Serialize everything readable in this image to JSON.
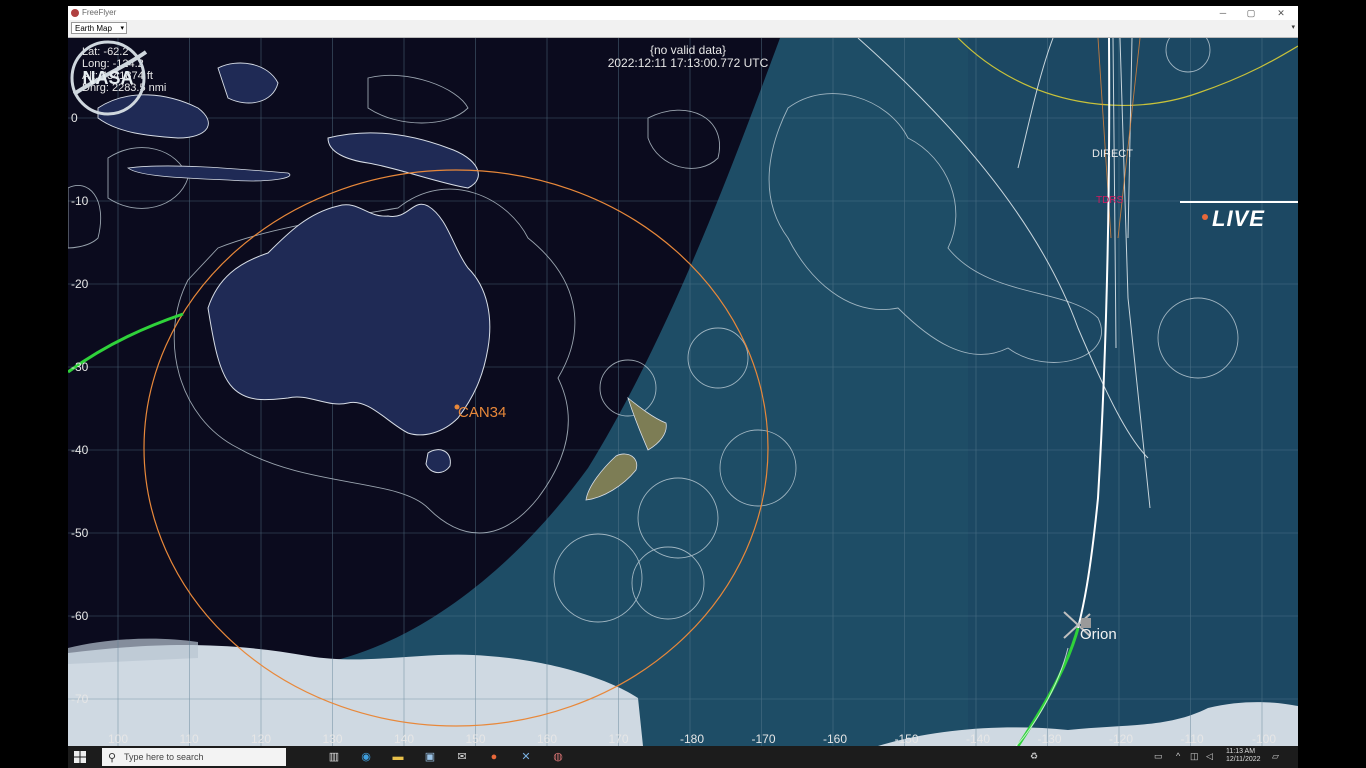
{
  "window": {
    "title": "FreeFlyer",
    "minimize": "─",
    "maximize": "▢",
    "close": "✕"
  },
  "toolbar": {
    "map_select_value": "Earth Map",
    "dropdown_arrow": "▾"
  },
  "readout": {
    "lat": "Lat:  -62.2",
    "long": "Long:  -124.2",
    "alt": "Alt:  4341874  ft",
    "dnrg": "Dnrg:  2283.5  nmi"
  },
  "status": {
    "no_data": "{no valid data}",
    "utc": "2022:12:11 17:13:00.772 UTC"
  },
  "labels": {
    "can34": "CAN34",
    "orion": "Orion",
    "direct": "DIRECT",
    "tdrs": "TDRS"
  },
  "axes": {
    "y_ticks": [
      "0",
      "-10",
      "-20",
      "-30",
      "-40",
      "-50",
      "-60",
      "-70"
    ],
    "x_ticks": [
      "100",
      "110",
      "120",
      "130",
      "140",
      "150",
      "160",
      "170",
      "-180",
      "-170",
      "-160",
      "-150",
      "-140",
      "-130",
      "-120",
      "-110",
      "-100"
    ]
  },
  "overlay": {
    "nasa_logo": "NASA",
    "live": "LIVE"
  },
  "taskbar": {
    "search_placeholder": "Type here to search",
    "time": "11:13 AM",
    "date": "12/11/2022"
  },
  "colors": {
    "night": "#0b0b1e",
    "ocean": "#1e4d66",
    "orbit_green": "#2fd23a",
    "can34_orange": "#e8883a",
    "live_orange": "#e8683a"
  }
}
